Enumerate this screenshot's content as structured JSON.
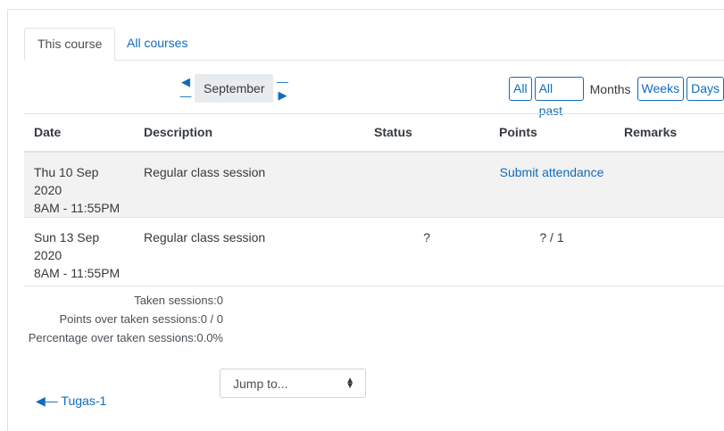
{
  "tabs": [
    {
      "label": "This course",
      "active": true
    },
    {
      "label": "All courses",
      "active": false
    }
  ],
  "month_nav": {
    "prev_icon": "left-arrow-icon",
    "label": "September",
    "next_icon": "right-arrow-icon"
  },
  "filters": {
    "all": "All",
    "all_past": "All past",
    "months": "Months",
    "weeks": "Weeks",
    "days": "Days"
  },
  "table": {
    "headers": [
      "Date",
      "Description",
      "Status",
      "Points",
      "Remarks"
    ],
    "rows": [
      {
        "date": "Thu 10 Sep 2020",
        "time": "8AM - 11:55PM",
        "description": "Regular class session",
        "status": "",
        "points": "Submit attendance",
        "remarks": ""
      },
      {
        "date": "Sun 13 Sep 2020",
        "time": "8AM - 11:55PM",
        "description": "Regular class session",
        "status": "?",
        "points": "? / 1",
        "remarks": ""
      }
    ]
  },
  "summary": {
    "taken_label": "Taken sessions:",
    "taken_value": "0",
    "points_label": "Points over taken sessions:",
    "points_value": "0 / 0",
    "percent_label": "Percentage over taken sessions:",
    "percent_value": "0.0%"
  },
  "jump": {
    "label": "Jump to..."
  },
  "prev_activity": {
    "icon": "left-arrow-icon",
    "label": "Tugas-1"
  },
  "colors": {
    "link": "#0f6cbf",
    "row_highlight": "#f2f2f2",
    "border": "#dee2e6"
  }
}
